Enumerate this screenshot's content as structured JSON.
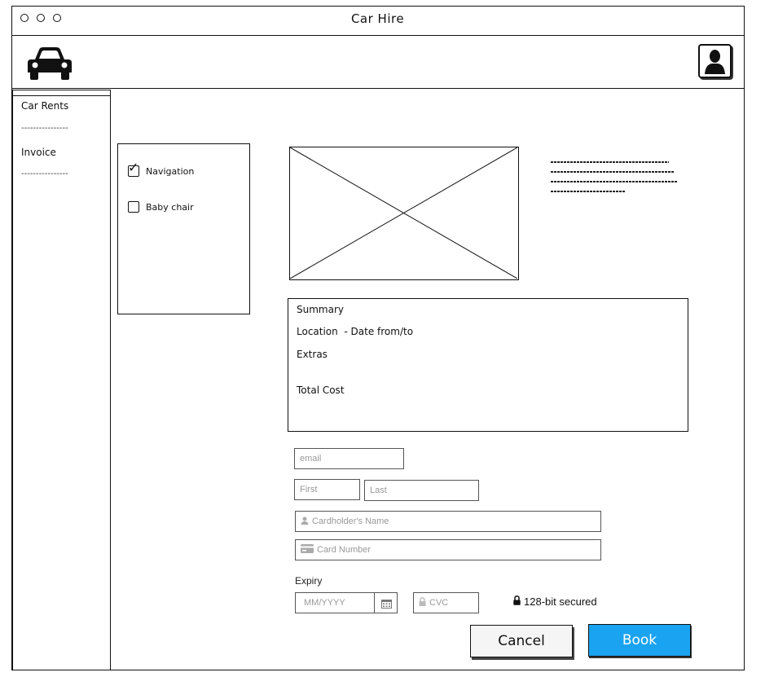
{
  "window": {
    "title": "Car Hire"
  },
  "header": {
    "logo_icon": "car-icon",
    "profile_icon": "user-silhouette-icon"
  },
  "sidebar": {
    "items": [
      {
        "label": "Car Rents",
        "separator": "----------------"
      },
      {
        "label": "Invoice",
        "separator": "----------------"
      }
    ]
  },
  "extras": {
    "options": [
      {
        "label": "Navigation",
        "checked": true
      },
      {
        "label": "Baby chair",
        "checked": false
      }
    ]
  },
  "car_preview": {
    "image_icon": "image-placeholder-icon"
  },
  "summary": {
    "heading": "Summary",
    "location_line": "Location  - Date from/to",
    "extras_label": "Extras",
    "total_label": "Total Cost"
  },
  "form": {
    "email_placeholder": "email",
    "first_placeholder": "First",
    "last_placeholder": "Last",
    "cardholder_placeholder": "Cardholder's Name",
    "card_number_placeholder": "Card Number",
    "expiry_label": "Expiry",
    "expiry_placeholder": "MM/YYYY",
    "cvc_placeholder": "CVC",
    "secured_text": "128-bit secured"
  },
  "actions": {
    "cancel_label": "Cancel",
    "book_label": "Book"
  },
  "colors": {
    "book_button": "#1aa3f0",
    "cancel_button": "#f5f5f5"
  }
}
